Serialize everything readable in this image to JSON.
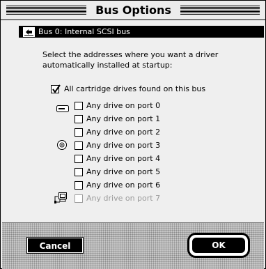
{
  "window": {
    "title": "Bus Options"
  },
  "bus": {
    "label": "Bus 0: Internal SCSI bus"
  },
  "instructions": "Select the addresses where you want a driver automatically installed at startup:",
  "all_cartridges": {
    "label": "All cartridge drives found on this bus",
    "checked": true
  },
  "ports": [
    {
      "label": "Any drive on port 0",
      "checked": false,
      "enabled": true,
      "icon": "hard-disk-icon"
    },
    {
      "label": "Any drive on port 1",
      "checked": false,
      "enabled": true,
      "icon": ""
    },
    {
      "label": "Any drive on port 2",
      "checked": false,
      "enabled": true,
      "icon": ""
    },
    {
      "label": "Any drive on port 3",
      "checked": false,
      "enabled": true,
      "icon": "cd-rom-icon"
    },
    {
      "label": "Any drive on port 4",
      "checked": false,
      "enabled": true,
      "icon": ""
    },
    {
      "label": "Any drive on port 5",
      "checked": false,
      "enabled": true,
      "icon": ""
    },
    {
      "label": "Any drive on port 6",
      "checked": false,
      "enabled": true,
      "icon": ""
    },
    {
      "label": "Any drive on port 7",
      "checked": false,
      "enabled": false,
      "icon": "computer-icon"
    }
  ],
  "buttons": {
    "cancel": "Cancel",
    "ok": "OK"
  }
}
